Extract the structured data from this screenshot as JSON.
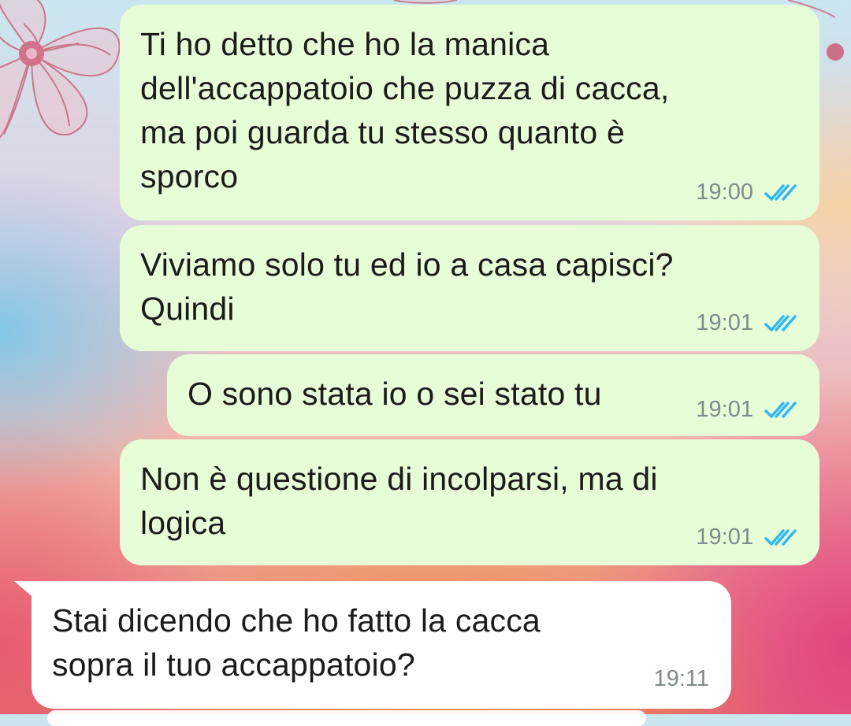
{
  "chat": {
    "messages": [
      {
        "direction": "outgoing",
        "text": "Ti ho detto che ho la manica\ndell'accappatoio che puzza di cacca,\nma poi guarda tu stesso quanto è\nsporco",
        "time": "19:00",
        "status_icon": "double-check-read-icon"
      },
      {
        "direction": "outgoing",
        "text": "Viviamo solo tu ed io a casa capisci?\nQuindi",
        "time": "19:01",
        "status_icon": "double-check-read-icon"
      },
      {
        "direction": "outgoing",
        "text": "O sono stata io o sei stato tu",
        "time": "19:01",
        "status_icon": "double-check-read-icon"
      },
      {
        "direction": "outgoing",
        "text": "Non è questione di incolparsi, ma di\nlogica",
        "time": "19:01",
        "status_icon": "double-check-read-icon"
      },
      {
        "direction": "incoming",
        "text": "Stai dicendo che ho fatto la cacca\nsopra il tuo accappatoio?",
        "time": "19:11"
      }
    ]
  },
  "colors": {
    "outgoing_bubble": "#e7fdd8",
    "incoming_bubble": "#ffffff",
    "read_tick": "#34b7f1",
    "timestamp": "#7f8a8c"
  }
}
